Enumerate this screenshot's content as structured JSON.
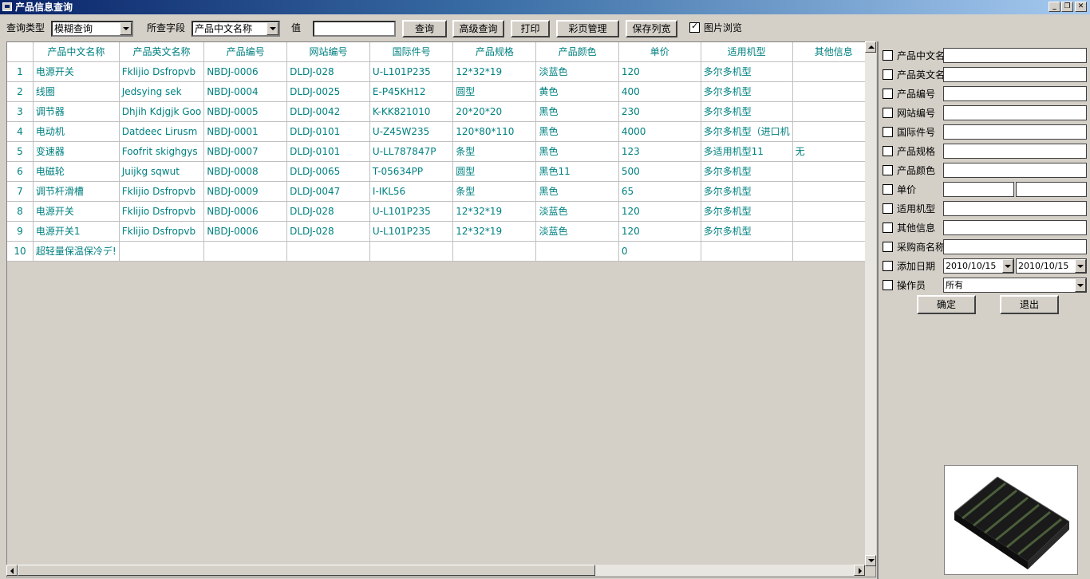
{
  "window": {
    "title": "产品信息查询",
    "icon": "app-icon",
    "min_glyph": "_",
    "max_glyph": "❐",
    "close_glyph": "✕"
  },
  "toolbar": {
    "query_type_label": "查询类型",
    "query_type_value": "模糊查询",
    "field_label": "所查字段",
    "field_value": "产品中文名称",
    "value_label": "值",
    "value_input": "",
    "search_button": "查询",
    "advanced_button": "高级查询",
    "print_button": "打印",
    "color_page_button": "彩页管理",
    "save_width_button": "保存列宽",
    "image_browse_label": "图片浏览",
    "image_browse_checked": true
  },
  "grid": {
    "columns": [
      "产品中文名称",
      "产品英文名称",
      "产品编号",
      "网站编号",
      "国际件号",
      "产品规格",
      "产品颜色",
      "单价",
      "适用机型",
      "其他信息"
    ],
    "rows": [
      [
        "1",
        "电源开关",
        "Fklijio Dsfropvb",
        "NBDJ-0006",
        "DLDJ-028",
        "U-L101P235",
        "12*32*19",
        "淡蓝色",
        "120",
        "多尔多机型",
        ""
      ],
      [
        "2",
        "线圈",
        "Jedsying sek",
        "NBDJ-0004",
        "DLDJ-0025",
        "E-P45KH12",
        "圆型",
        "黄色",
        "400",
        "多尔多机型",
        ""
      ],
      [
        "3",
        "调节器",
        "Dhjih Kdjgjk Goo",
        "NBDJ-0005",
        "DLDJ-0042",
        "K-KK821010",
        "20*20*20",
        "黑色",
        "230",
        "多尔多机型",
        ""
      ],
      [
        "4",
        "电动机",
        "Datdeec Lirusm",
        "NBDJ-0001",
        "DLDJ-0101",
        "U-Z45W235",
        "120*80*110",
        "黑色",
        "4000",
        "多尔多机型（进口机",
        ""
      ],
      [
        "5",
        "变速器",
        "Foofrit skighgys",
        "NBDJ-0007",
        "DLDJ-0101",
        "U-LL787847P",
        "条型",
        "黑色",
        "123",
        "多适用机型11",
        "无"
      ],
      [
        "6",
        "电磁轮",
        "Juijkg sqwut",
        "NBDJ-0008",
        "DLDJ-0065",
        "T-05634PP",
        "圆型",
        "黑色11",
        "500",
        "多尔多机型",
        ""
      ],
      [
        "7",
        "调节杆滑槽",
        "Fklijio Dsfropvb",
        "NBDJ-0009",
        "DLDJ-0047",
        "I-IKL56",
        "条型",
        "黑色",
        "65",
        "多尔多机型",
        ""
      ],
      [
        "8",
        "电源开关",
        "Fklijio Dsfropvb",
        "NBDJ-0006",
        "DLDJ-028",
        "U-L101P235",
        "12*32*19",
        "淡蓝色",
        "120",
        "多尔多机型",
        ""
      ],
      [
        "9",
        "电源开关1",
        "Fklijio Dsfropvb",
        "NBDJ-0006",
        "DLDJ-028",
        "U-L101P235",
        "12*32*19",
        "淡蓝色",
        "120",
        "多尔多机型",
        ""
      ],
      [
        "10",
        "超轻量保温保冷デ!",
        "",
        "",
        "",
        "",
        "",
        "",
        "0",
        "",
        ""
      ]
    ]
  },
  "panel": {
    "filters": [
      "产品中文名",
      "产品英文名",
      "产品编号",
      "网站编号",
      "国际件号",
      "产品规格",
      "产品颜色",
      "单价",
      "适用机型",
      "其他信息",
      "采购商名称",
      "添加日期",
      "操作员"
    ],
    "date_from": "2010/10/15",
    "date_to": "2010/10/15",
    "operator_value": "所有",
    "ok_button": "确定",
    "exit_button": "退出"
  },
  "colors": {
    "titlebar": "#0a246a",
    "grid_text": "#008080",
    "face": "#d4d0c8"
  }
}
